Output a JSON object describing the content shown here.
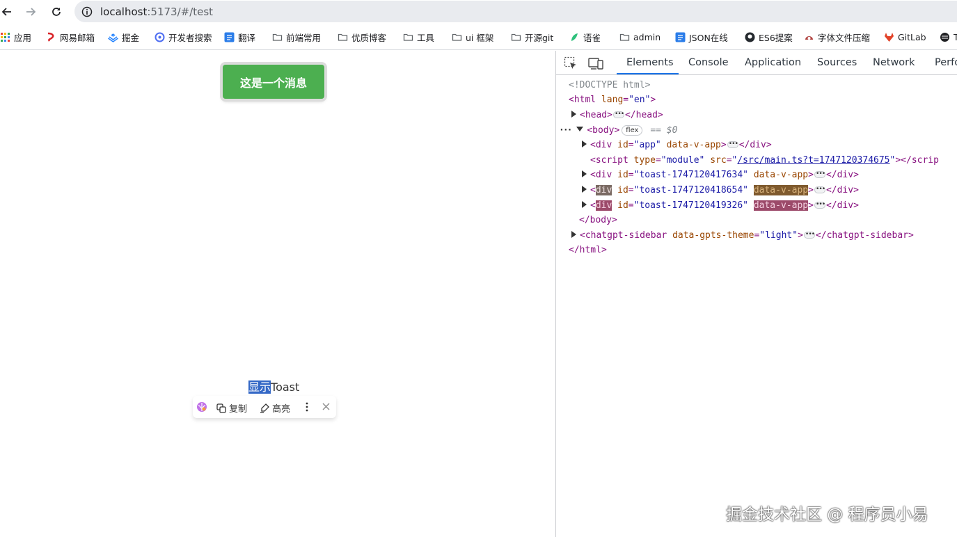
{
  "browser": {
    "url_host": "localhost",
    "url_rest": ":5173/#/test"
  },
  "bookmarks": [
    {
      "label": "应用",
      "icon": "apps-grid-icon",
      "color": "#4285f4"
    },
    {
      "label": "网易邮箱",
      "icon": "netease-mail-icon",
      "color": "#d9252a"
    },
    {
      "label": "掘金",
      "icon": "juejin-icon",
      "color": "#1e80ff"
    },
    {
      "label": "开发者搜索",
      "icon": "dev-search-icon",
      "color": "#4e6ef2"
    },
    {
      "label": "翻译",
      "icon": "translate-icon",
      "color": "#2b7de9"
    },
    {
      "label": "前端常用",
      "icon": "folder-icon",
      "color": "#5f6368"
    },
    {
      "label": "优质博客",
      "icon": "folder-icon",
      "color": "#5f6368"
    },
    {
      "label": "工具",
      "icon": "folder-icon",
      "color": "#5f6368"
    },
    {
      "label": "ui 框架",
      "icon": "folder-icon",
      "color": "#5f6368"
    },
    {
      "label": "开源git",
      "icon": "folder-icon",
      "color": "#5f6368"
    },
    {
      "label": "语雀",
      "icon": "yuque-icon",
      "color": "#2ec17c"
    },
    {
      "label": "admin",
      "icon": "folder-icon",
      "color": "#5f6368"
    },
    {
      "label": "JSON在线",
      "icon": "json-icon",
      "color": "#2b7de9"
    },
    {
      "label": "ES6提案",
      "icon": "github-icon",
      "color": "#24292e"
    },
    {
      "label": "字体文件压缩",
      "icon": "font-compress-icon",
      "color": "#b0413e"
    },
    {
      "label": "GitLab",
      "icon": "gitlab-icon",
      "color": "#e24329"
    },
    {
      "label": "T",
      "icon": "globe-icon",
      "color": "#202124"
    }
  ],
  "page": {
    "toast_text": "这是一个消息",
    "show_toast_selected": "显示",
    "show_toast_rest": "Toast",
    "popbar": {
      "copy": "复制",
      "highlight": "高亮"
    }
  },
  "devtools": {
    "tabs": [
      "Elements",
      "Console",
      "Application",
      "Sources",
      "Network",
      "Perfor"
    ],
    "active_tab": "Elements",
    "dom": {
      "doctype": "<!DOCTYPE html>",
      "html_open": "<html",
      "html_lang_attr": "lang",
      "html_lang_val": "\"en\"",
      "head": "<head>",
      "head_close": "</head>",
      "body_open": "<body>",
      "body_badge": "flex",
      "body_selected": "== $0",
      "div": "div",
      "id_attr": "id",
      "app_id": "\"app\"",
      "data_v_app": "data-v-app",
      "div_close": "</div>",
      "script_open": "<script",
      "type_attr": "type",
      "type_val": "\"module\"",
      "src_attr": "src",
      "src_val": "/src/main.ts?t=1747120374675",
      "script_close": "></scrip",
      "toast1_id": "\"toast-1747120417634\"",
      "toast2_id": "\"toast-1747120418654\"",
      "toast3_id": "\"toast-1747120419326\"",
      "body_close": "</body>",
      "sidebar_open": "<chatgpt-sidebar",
      "sidebar_attr": "data-gpts-theme",
      "sidebar_val": "\"light\"",
      "sidebar_close": "</chatgpt-sidebar>",
      "html_close": "</html>"
    }
  },
  "watermark": "掘金技术社区 @ 程序员小易"
}
